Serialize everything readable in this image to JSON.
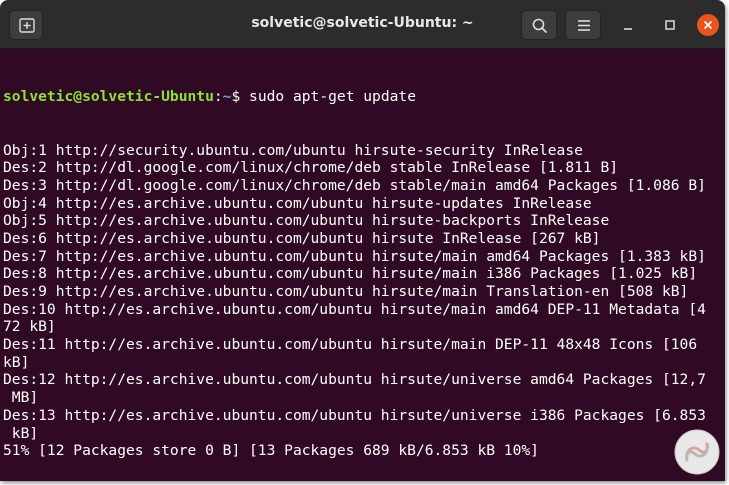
{
  "window": {
    "title": "solvetic@solvetic-Ubuntu: ~",
    "buttons": {
      "new_tab_icon": "new-tab-icon",
      "search_icon": "search-icon",
      "menu_icon": "hamburger-menu-icon",
      "minimize_icon": "minimize-icon",
      "maximize_icon": "maximize-icon",
      "close_icon": "close-icon"
    }
  },
  "colors": {
    "terminal_bg": "#300a24",
    "prompt_user": "#8ae234",
    "prompt_path": "#729fcf",
    "close_button": "#e95420"
  },
  "terminal": {
    "prompt": {
      "user_host": "solvetic@solvetic-Ubuntu",
      "colon": ":",
      "path": "~",
      "symbol": "$ ",
      "command": "sudo apt-get update"
    },
    "lines": [
      "Obj:1 http://security.ubuntu.com/ubuntu hirsute-security InRelease",
      "Des:2 http://dl.google.com/linux/chrome/deb stable InRelease [1.811 B]",
      "Des:3 http://dl.google.com/linux/chrome/deb stable/main amd64 Packages [1.086 B]",
      "Obj:4 http://es.archive.ubuntu.com/ubuntu hirsute-updates InRelease",
      "Obj:5 http://es.archive.ubuntu.com/ubuntu hirsute-backports InRelease",
      "Des:6 http://es.archive.ubuntu.com/ubuntu hirsute InRelease [267 kB]",
      "Des:7 http://es.archive.ubuntu.com/ubuntu hirsute/main amd64 Packages [1.383 kB]",
      "Des:8 http://es.archive.ubuntu.com/ubuntu hirsute/main i386 Packages [1.025 kB]",
      "Des:9 http://es.archive.ubuntu.com/ubuntu hirsute/main Translation-en [508 kB]",
      "Des:10 http://es.archive.ubuntu.com/ubuntu hirsute/main amd64 DEP-11 Metadata [4",
      "72 kB]",
      "Des:11 http://es.archive.ubuntu.com/ubuntu hirsute/main DEP-11 48x48 Icons [106",
      "kB]",
      "Des:12 http://es.archive.ubuntu.com/ubuntu hirsute/universe amd64 Packages [12,7",
      " MB]",
      "Des:13 http://es.archive.ubuntu.com/ubuntu hirsute/universe i386 Packages [6.853",
      " kB]",
      "51% [12 Packages store 0 B] [13 Packages 689 kB/6.853 kB 10%]"
    ]
  },
  "watermark": {
    "icon": "solvetic-logo-icon"
  }
}
